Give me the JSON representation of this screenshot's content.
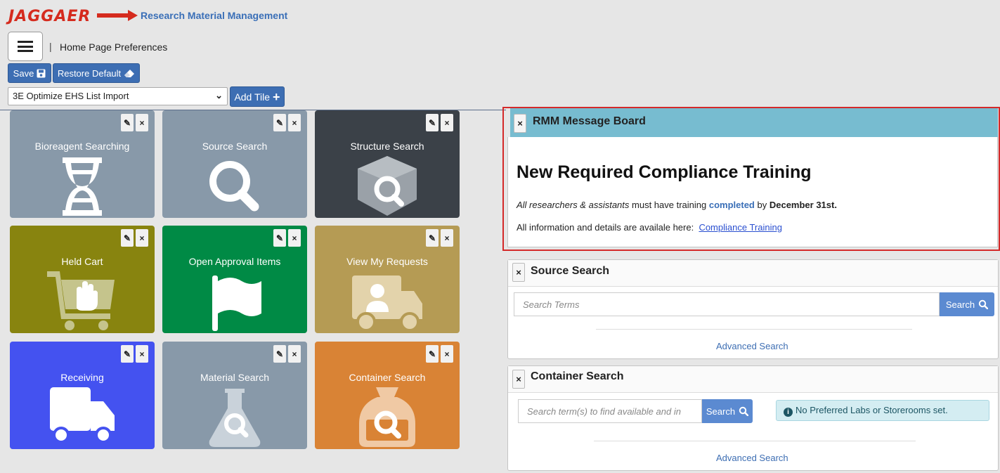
{
  "header": {
    "logo_text": "JAGGAER",
    "app_title": "Research Material Management"
  },
  "toolbar": {
    "separator": "|",
    "page_title": "Home Page Preferences",
    "save_label": "Save",
    "restore_label": "Restore Default",
    "tile_select_value": "3E Optimize EHS List Import",
    "add_tile_label": "Add Tile"
  },
  "tiles": [
    {
      "label": "Bioreagent Searching",
      "color": "#8899a9",
      "icon": "dna-icon"
    },
    {
      "label": "Source Search",
      "color": "#8899a9",
      "icon": "magnifier-icon"
    },
    {
      "label": "Structure Search",
      "color": "#3b4148",
      "icon": "cube-search-icon"
    },
    {
      "label": "Held Cart",
      "color": "#88840f",
      "icon": "cart-hand-icon"
    },
    {
      "label": "Open Approval Items",
      "color": "#008a45",
      "icon": "flag-icon"
    },
    {
      "label": "View My Requests",
      "color": "#b59b54",
      "icon": "truck-user-icon"
    },
    {
      "label": "Receiving",
      "color": "#4452f0",
      "icon": "truck-icon"
    },
    {
      "label": "Material Search",
      "color": "#8899a9",
      "icon": "flask-search-icon"
    },
    {
      "label": "Container Search",
      "color": "#d98335",
      "icon": "bag-search-icon"
    }
  ],
  "message_board": {
    "title": "RMM Message Board",
    "headline": "New Required Compliance Training",
    "line1_italic": "All researchers & assistants",
    "line1_mid": " must have training ",
    "line1_strong": "completed",
    "line1_by": " by ",
    "line1_date": "December 31st.",
    "line2_text": "All information and details are availale here:",
    "line2_link": "Compliance Training"
  },
  "source_search": {
    "title": "Source Search",
    "placeholder": "Search Terms",
    "button": "Search",
    "advanced": "Advanced Search"
  },
  "container_search": {
    "title": "Container Search",
    "placeholder": "Search term(s) to find available and in",
    "button": "Search",
    "info": "No Preferred Labs or Storerooms set.",
    "advanced": "Advanced Search"
  },
  "close_symbol": "×"
}
